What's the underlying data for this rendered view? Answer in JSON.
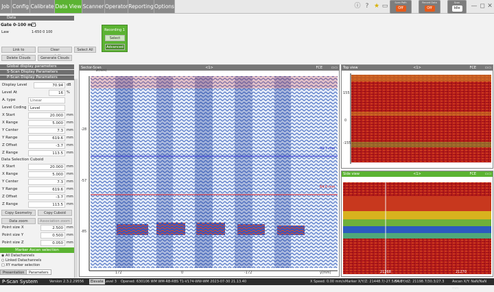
{
  "menu": {
    "items": [
      "Job",
      "Config",
      "Calibrate",
      "Data View",
      "Scanner",
      "Operator",
      "Reporting",
      "Options"
    ],
    "active_index": 3,
    "active_color": "#5bb332",
    "indicators": [
      {
        "label": "Scan Path",
        "value": "Off"
      },
      {
        "label": "Record Data",
        "value": "Off"
      },
      {
        "label": "Scan",
        "value": "Idle"
      }
    ]
  },
  "data_section": {
    "title": "Data",
    "gate_label": "Gate 0-100 mm",
    "law_label": "Law",
    "law_values": "1-650  0  100",
    "recording_label": "Recording 1",
    "select_button": "Select",
    "advanced_button": "Advanced",
    "link_button": "Link to presentations",
    "clear_button": "Clear presentations",
    "select_all_button": "Select All",
    "delete_clouds_button": "Delete Clouds",
    "generate_clouds_button": "Generate Clouds"
  },
  "sections": {
    "global": "Global display parameters",
    "sscan": "S-Scan Display Parameters",
    "pscan": "P-Scan Display Parameters"
  },
  "display": {
    "display_level": {
      "label": "Display Level",
      "value": "70.94",
      "unit": "dB"
    },
    "level_at": {
      "label": "Level At",
      "value": "16",
      "unit": "%"
    },
    "a_type": {
      "label": "A. type",
      "value": "Linear"
    },
    "level_coding": {
      "label": "Level Coding",
      "value": "Level"
    },
    "geom": [
      {
        "label": "X Start",
        "value": "20.000",
        "unit": "mm"
      },
      {
        "label": "X Range",
        "value": "5.000",
        "unit": "mm"
      },
      {
        "label": "Y Center",
        "value": "7.3",
        "unit": "mm"
      },
      {
        "label": "Y Range",
        "value": "619.6",
        "unit": "mm"
      },
      {
        "label": "Z Offset",
        "value": "-3.7",
        "unit": "mm"
      },
      {
        "label": "Z Range",
        "value": "113.5",
        "unit": "mm"
      }
    ]
  },
  "cuboid": {
    "title": "Data Selection Cuboid",
    "rows": [
      {
        "label": "X Start",
        "value": "20.000",
        "unit": "mm"
      },
      {
        "label": "X Range",
        "value": "5.000",
        "unit": "mm"
      },
      {
        "label": "Y Center",
        "value": "7.3",
        "unit": "mm"
      },
      {
        "label": "Y Range",
        "value": "619.6",
        "unit": "mm"
      },
      {
        "label": "Z Offset",
        "value": "-3.7",
        "unit": "mm"
      },
      {
        "label": "Z Range",
        "value": "113.5",
        "unit": "mm"
      }
    ],
    "copy_geometry": "Copy Geometry",
    "copy_cuboid": "Copy Cuboid",
    "data_zoom": "Data zoom",
    "ascan_zoom": "Association zoom",
    "point_size": [
      {
        "label": "Point size X",
        "value": "2.500",
        "unit": "mm"
      },
      {
        "label": "Point size Y",
        "value": "0.500",
        "unit": "mm"
      },
      {
        "label": "Point size Z",
        "value": "0.050",
        "unit": "mm"
      }
    ],
    "marker_ascan": "Marker Ascan selection",
    "checks": [
      "All Datachannels",
      "Linked Datachannels",
      "XY marker selection"
    ]
  },
  "tabs": [
    "Presentation",
    "Parameters"
  ],
  "sector_scan": {
    "title": "Sector-Scan",
    "center": "<1>",
    "right_label": "FCE",
    "legend": "Z(mm)",
    "y_ticks": [
      "-28",
      "-57",
      "-85"
    ],
    "x_ticks": [
      "172",
      "0",
      "-172"
    ],
    "x_unit": "y(mm)",
    "marker_blue": "42.7 mm",
    "marker_red": "64.0 mm"
  },
  "top_view": {
    "title": "Top view",
    "center": "<1>",
    "right_label": "FCE",
    "y_ticks": [
      "155",
      "0",
      "-155"
    ],
    "x_ticks": [
      "21268",
      "21270"
    ]
  },
  "side_view": {
    "title": "Side view",
    "center": "<1>",
    "right_label": "FCE",
    "x_ticks": [
      "21268",
      "21270"
    ]
  },
  "status": {
    "app": "P-Scan System",
    "version": "Version 2.3.2.29556",
    "level_btn": "Elevate",
    "level": "Level 3",
    "opened": "Opened: 630106 WM WM-RB-RBS T1-V174-WW-WM 2023-07-30 21.13.40",
    "xspeed": "X Speed: 0.00 mm/s",
    "marker": "Marker X/Y/Z: 21448.7/-27.5/54.0",
    "delta": "dX/dY/dZ: 21198.7/30.3/27.3",
    "ascan": "Ascan X/Y: NaN/NaN mm"
  }
}
